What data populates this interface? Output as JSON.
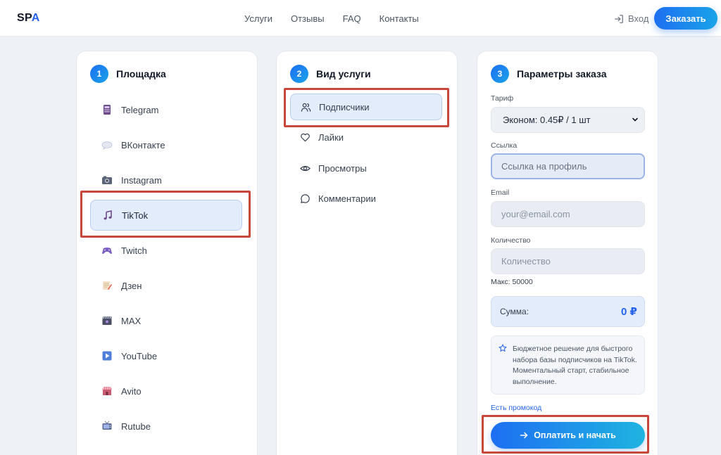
{
  "header": {
    "logo_part1": "SP",
    "logo_part2": "A",
    "nav": [
      "Услуги",
      "Отзывы",
      "FAQ",
      "Контакты"
    ],
    "login_label": "Вход",
    "order_label": "Заказать"
  },
  "step1": {
    "number": "1",
    "title": "Площадка",
    "platforms": [
      {
        "label": "Telegram",
        "icon": "telegram-icon"
      },
      {
        "label": "ВКонтакте",
        "icon": "vk-icon"
      },
      {
        "label": "Instagram",
        "icon": "instagram-icon"
      },
      {
        "label": "TikTok",
        "icon": "tiktok-icon",
        "active": true
      },
      {
        "label": "Twitch",
        "icon": "twitch-icon"
      },
      {
        "label": "Дзен",
        "icon": "dzen-icon"
      },
      {
        "label": "MAX",
        "icon": "max-icon"
      },
      {
        "label": "YouTube",
        "icon": "youtube-icon"
      },
      {
        "label": "Avito",
        "icon": "avito-icon"
      },
      {
        "label": "Rutube",
        "icon": "rutube-icon"
      }
    ]
  },
  "step2": {
    "number": "2",
    "title": "Вид услуги",
    "services": [
      {
        "label": "Подписчики",
        "icon": "users-icon",
        "active": true
      },
      {
        "label": "Лайки",
        "icon": "heart-icon"
      },
      {
        "label": "Просмотры",
        "icon": "eye-icon"
      },
      {
        "label": "Комментарии",
        "icon": "comment-icon"
      }
    ]
  },
  "step3": {
    "number": "3",
    "title": "Параметры заказа",
    "tariff_label": "Тариф",
    "tariff_value": "Эконом: 0.45₽ / 1 шт",
    "link_label": "Ссылка",
    "link_placeholder": "Ссылка на профиль",
    "email_label": "Email",
    "email_placeholder": "your@email.com",
    "qty_label": "Количество",
    "qty_placeholder": "Количество",
    "max_note": "Макс: 50000",
    "sum_label": "Сумма:",
    "sum_value": "0 ₽",
    "info_text": "Бюджетное решение для быстрого набора базы подписчиков на TikTok. Моментальный старт, стабильное выполнение.",
    "promo_label": "Есть промокод",
    "pay_label": "Оплатить и начать"
  },
  "colors": {
    "accent": "#2563eb",
    "highlight_frame": "#c9473a",
    "active_bg": "#e3ecfb"
  }
}
